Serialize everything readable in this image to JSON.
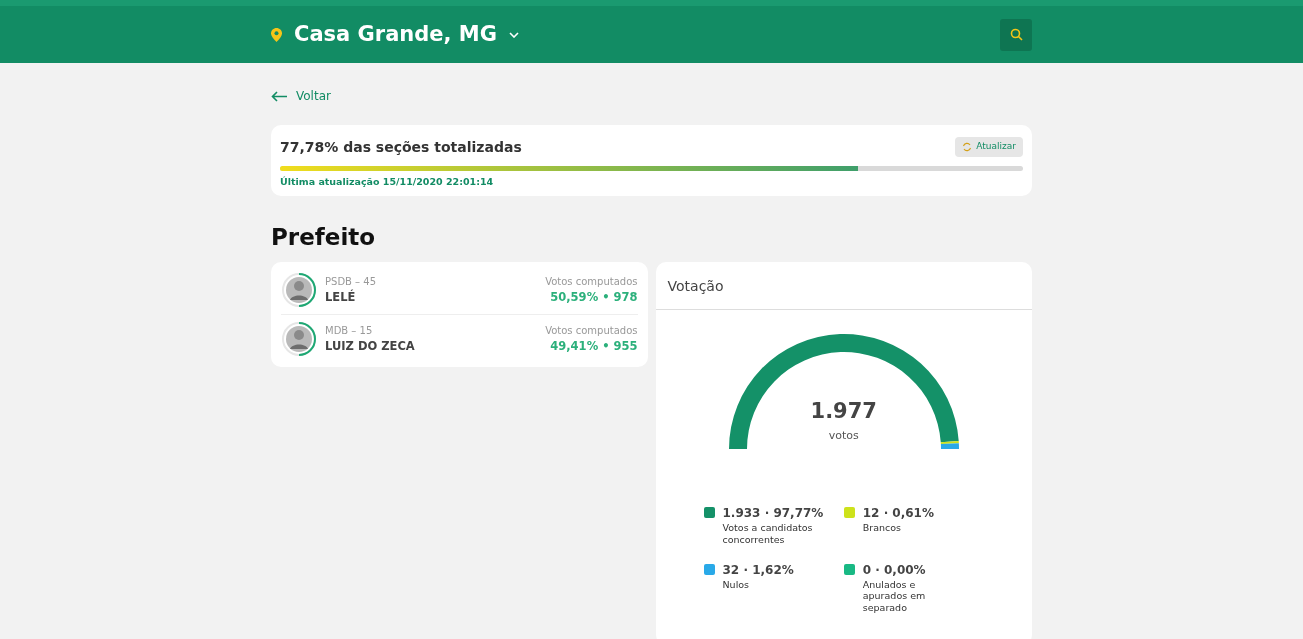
{
  "header": {
    "location": "Casa Grande, MG"
  },
  "back_link": "Voltar",
  "progress": {
    "title": "77,78% das seções totalizadas",
    "button": "Atualizar",
    "level": 0.7778,
    "updated": "Última atualização 15/11/2020 22:01:14"
  },
  "section_title": "Prefeito",
  "candidates": [
    {
      "party": "PSDB – 45",
      "name": "LELÉ",
      "votes_label": "Votos computados",
      "percent": "50,59%",
      "separator": "•",
      "votes": "978"
    },
    {
      "party": "MDB – 15",
      "name": "LUIZ DO ZECA",
      "votes_label": "Votos computados",
      "percent": "49,41%",
      "separator": "•",
      "votes": "955"
    }
  ],
  "voting": {
    "title": "Votação",
    "total": "1.977",
    "total_label": "votos",
    "chart_data": {
      "type": "donut",
      "categories": [
        "Votos a candidatos concorrentes",
        "Brancos",
        "Nulos",
        "Anulados e apurados em separado"
      ],
      "values": [
        97.77,
        0.61,
        1.62,
        0
      ]
    },
    "legend": [
      {
        "value": "1.933 · 97,77%",
        "color": "#149168"
      },
      {
        "value": "12 · 0,61%",
        "color": "#cde21b"
      },
      {
        "value": "32 · 1,62%",
        "color": "#29a9e8"
      },
      {
        "value": "0 · 0,00%",
        "color": "#19b984"
      }
    ]
  }
}
